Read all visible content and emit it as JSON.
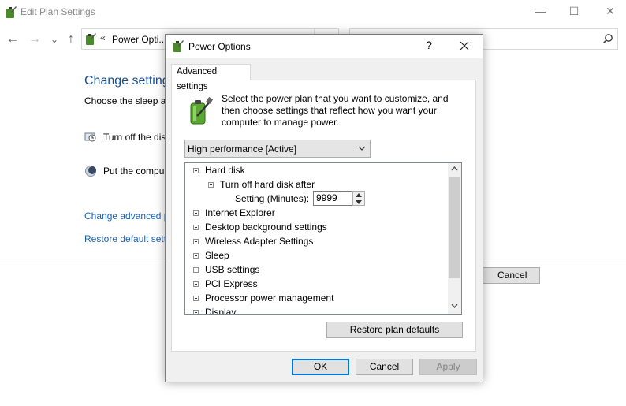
{
  "background_window": {
    "title": "Edit Plan Settings",
    "controls": {
      "minimize": "—",
      "maximize": "☐",
      "close": "✕"
    },
    "nav": {
      "back": "←",
      "forward": "→",
      "recent": "⌄",
      "up": "↑"
    },
    "address": {
      "chevron": "«",
      "text": "Power Opti..."
    },
    "heading": "Change setting",
    "subtitle": "Choose the sleep an",
    "rows": [
      {
        "label": "Turn off the dis",
        "icon": "monitor-clock-icon"
      },
      {
        "label": "Put the compu",
        "icon": "moon-icon"
      }
    ],
    "links": [
      "Change advanced p",
      "Restore default setti"
    ],
    "cancel_label": "Cancel"
  },
  "dialog": {
    "title": "Power Options",
    "help": "?",
    "tab_label": "Advanced settings",
    "description": "Select the power plan that you want to customize, and then choose settings that reflect how you want your computer to manage power.",
    "plan_select": "High performance [Active]",
    "tree": [
      {
        "label": "Hard disk",
        "expander": "minus"
      },
      {
        "label": "Turn off hard disk after",
        "expander": "minus"
      },
      {
        "label": "Setting (Minutes):",
        "value": "9999"
      },
      {
        "label": "Internet Explorer",
        "expander": "plus"
      },
      {
        "label": "Desktop background settings",
        "expander": "plus"
      },
      {
        "label": "Wireless Adapter Settings",
        "expander": "plus"
      },
      {
        "label": "Sleep",
        "expander": "plus"
      },
      {
        "label": "USB settings",
        "expander": "plus"
      },
      {
        "label": "PCI Express",
        "expander": "plus"
      },
      {
        "label": "Processor power management",
        "expander": "plus"
      },
      {
        "label": "Display",
        "expander": "plus"
      }
    ],
    "restore_label": "Restore plan defaults",
    "ok_label": "OK",
    "cancel_label": "Cancel",
    "apply_label": "Apply"
  },
  "colors": {
    "link": "#1a63b8",
    "heading": "#1e4e8c",
    "focus_border": "#0078d7"
  }
}
